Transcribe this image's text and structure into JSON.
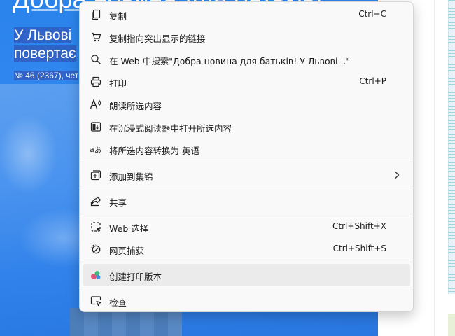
{
  "background": {
    "headline": "Добра новина для батьків!",
    "subheadline_line1": "У Львові",
    "subheadline_line2": "повертає",
    "meta": "№ 46 (2367), чет"
  },
  "menu": {
    "items": [
      {
        "label": "复制",
        "shortcut": "Ctrl+C",
        "icon": "copy-icon"
      },
      {
        "label": "复制指向突出显示的链接",
        "shortcut": "",
        "icon": "copy-link-icon"
      },
      {
        "label": "在 Web 中搜索\"Добра новина для батьків! У Львові...\"",
        "shortcut": "",
        "icon": "search-icon"
      },
      {
        "label": "打印",
        "shortcut": "Ctrl+P",
        "icon": "print-icon"
      },
      {
        "label": "朗读所选内容",
        "shortcut": "",
        "icon": "read-aloud-icon"
      },
      {
        "label": "在沉浸式阅读器中打开所选内容",
        "shortcut": "",
        "icon": "immersive-reader-icon"
      },
      {
        "label": "将所选内容转换为 英语",
        "shortcut": "",
        "icon": "translate-icon"
      },
      {
        "label": "添加到集锦",
        "shortcut": "",
        "icon": "collections-icon"
      },
      {
        "label": "共享",
        "shortcut": "",
        "icon": "share-icon"
      },
      {
        "label": "Web 选择",
        "shortcut": "Ctrl+Shift+X",
        "icon": "web-select-icon"
      },
      {
        "label": "网页捕获",
        "shortcut": "Ctrl+Shift+S",
        "icon": "web-capture-icon"
      },
      {
        "label": "创建打印版本",
        "shortcut": "",
        "icon": "print-friendly-icon"
      },
      {
        "label": "检查",
        "shortcut": "",
        "icon": "inspect-icon"
      }
    ]
  },
  "colors": {
    "hero_blue": "#2f86ee",
    "menu_bg": "#f9f9f9",
    "hover_bg": "#ebebeb",
    "selection_blue": "#2f63c8"
  }
}
